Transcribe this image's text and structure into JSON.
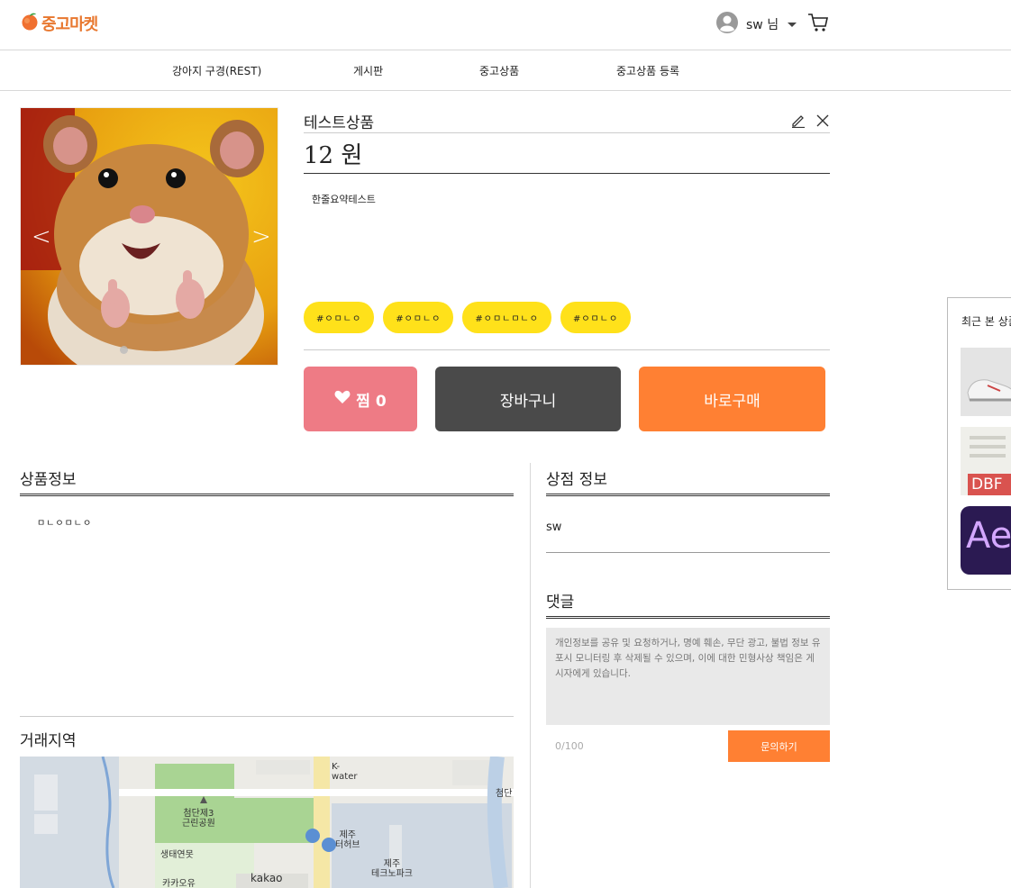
{
  "header": {
    "logo_text": "중고마켓",
    "user_name": "sw 님"
  },
  "nav": {
    "items": [
      "강아지 구경(REST)",
      "게시판",
      "중고상품",
      "중고상품 등록"
    ]
  },
  "gallery": {
    "prev": "<",
    "next": ">"
  },
  "product": {
    "name": "테스트상품",
    "price": "12 원",
    "summary": "한줄요약테스트",
    "tags": [
      "#ㅇㅁㄴㅇ",
      "#ㅇㅁㄴㅇ",
      "#ㅇㅁㄴㅁㄴㅇ",
      "#ㅇㅁㄴㅇ"
    ]
  },
  "actions": {
    "like_label": "찜 0",
    "cart_label": "장바구니",
    "buy_label": "바로구매"
  },
  "sections": {
    "product_info_title": "상품정보",
    "product_info_content": "ㅁㄴㅇㅁㄴㅇ",
    "store_info_title": "상점 정보",
    "store_name": "sw",
    "comments_title": "댓글",
    "comment_placeholder": "개인정보를 공유 및 요청하거나, 명예 훼손, 무단 광고, 불법 정보 유포시 모니터링 후 삭제될 수 있으며, 이에 대한 민형사상 책임은 게시자에게 있습니다.",
    "comment_count": "0/100",
    "ask_label": "문의하기",
    "region_title": "거래지역"
  },
  "map": {
    "labels": [
      "K-\nwater",
      "첨단제3\n근린공원",
      "제주\n터허브",
      "생태연못",
      "제주\n테크노파크",
      "kakao",
      "첨단",
      "카카오유"
    ]
  },
  "recent": {
    "title": "최근 본 상품",
    "items": [
      "sneaker-thumb",
      "dbf-file-thumb",
      "after-effects-thumb"
    ],
    "dbf_text": "DBF",
    "ae_text": "Ae"
  },
  "colors": {
    "brand": "#e8772e",
    "like": "#ee7b85",
    "cart": "#4a4a4a",
    "buy": "#ff8033",
    "tag": "#ffe11a"
  }
}
